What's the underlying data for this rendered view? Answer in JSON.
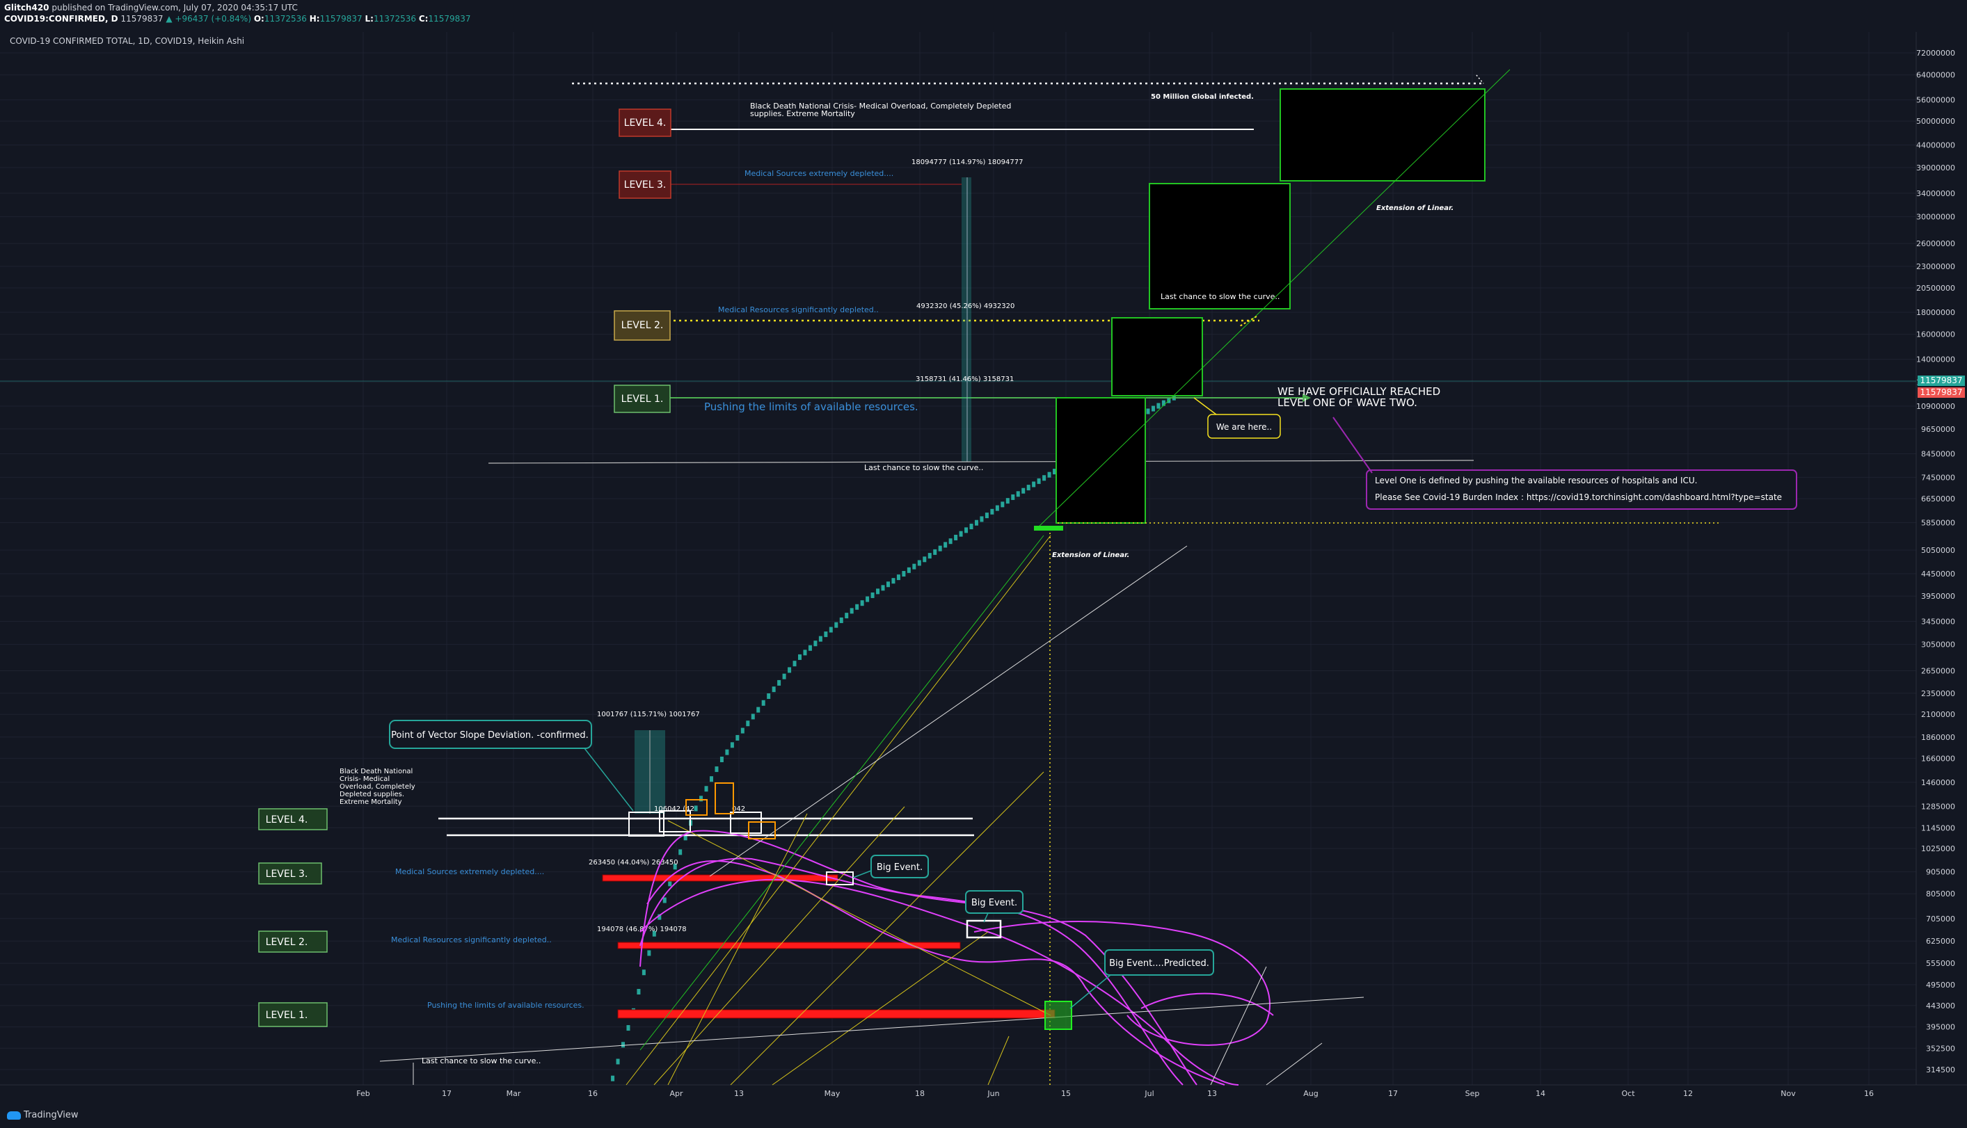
{
  "header": {
    "user": "Glitch420",
    "published": " published on TradingView.com, July 07, 2020 04:35:17 UTC",
    "symbol": "COVID19:CONFIRMED, D",
    "last": "11579837",
    "change": "▲ +96437 (+0.84%)",
    "o_label": "O:",
    "o": "11372536",
    "h_label": "H:",
    "h": "11579837",
    "l_label": "L:",
    "l": "11372536",
    "c_label": "C:",
    "c": "11579837"
  },
  "chart_legend": "COVID-19 CONFIRMED TOTAL, 1D, COVID19, Heikin Ashi",
  "footer": {
    "brand": "TradingView"
  },
  "price_badges": {
    "top": "11579837",
    "bottom": "11579837"
  },
  "colors": {
    "background": "#131722",
    "candle": "#26a69a",
    "level1": "#4caf50",
    "level2": "#f5e01e",
    "level3": "#ff4040",
    "magenta": "#e040fb",
    "red_band": "#ff1a1a",
    "green_box": "#22dd22"
  },
  "chart_data": {
    "type": "line",
    "title": "COVID-19 CONFIRMED TOTAL, 1D, COVID19, Heikin Ashi",
    "y_scale": "log",
    "x_ticks": [
      "Feb",
      "17",
      "Mar",
      "16",
      "Apr",
      "13",
      "May",
      "18",
      "Jun",
      "15",
      "Jul",
      "13",
      "Aug",
      "17",
      "Sep",
      "14",
      "Oct",
      "12",
      "Nov",
      "16"
    ],
    "y_ticks": [
      "72000000",
      "64000000",
      "56000000",
      "50000000",
      "44000000",
      "39000000",
      "34000000",
      "30000000",
      "26000000",
      "23000000",
      "20500000",
      "18000000",
      "16000000",
      "14000000",
      "12400000",
      "10900000",
      "9650000",
      "8450000",
      "7450000",
      "6650000",
      "5850000",
      "5050000",
      "4450000",
      "3950000",
      "3450000",
      "3050000",
      "2650000",
      "2350000",
      "2100000",
      "1860000",
      "1660000",
      "1460000",
      "1285000",
      "1145000",
      "1025000",
      "905000",
      "805000",
      "705000",
      "625000",
      "555000",
      "495000",
      "443000",
      "395000",
      "352500",
      "314500"
    ],
    "series": [
      {
        "x": [
          "2020-03-20",
          "2020-03-24",
          "2020-03-28",
          "2020-04-01",
          "2020-04-05",
          "2020-04-10",
          "2020-04-15",
          "2020-04-20",
          "2020-04-25",
          "2020-05-01",
          "2020-05-05",
          "2020-05-10",
          "2020-05-15",
          "2020-05-20",
          "2020-05-25",
          "2020-06-01",
          "2020-06-05",
          "2020-06-10",
          "2020-06-15",
          "2020-06-20",
          "2020-06-25",
          "2020-07-01",
          "2020-07-07"
        ],
        "y": [
          300000,
          430000,
          650000,
          930000,
          1270000,
          1650000,
          2000000,
          2400000,
          2850000,
          3300000,
          3650000,
          4050000,
          4450000,
          4900000,
          5400000,
          6200000,
          6700000,
          7300000,
          7950000,
          8750000,
          9650000,
          10600000,
          11579837
        ]
      }
    ],
    "last_value": 11579837
  },
  "annotations": {
    "top_levels": [
      {
        "label": "LEVEL 4.",
        "text": "Black Death National Crisis- Medical Overload, Completely Depleted supplies. Extreme Mortality"
      },
      {
        "label": "LEVEL 3.",
        "text": "Medical Sources extremely depleted...."
      },
      {
        "label": "LEVEL 2.",
        "text": "Medical Resources significantly depleted.."
      },
      {
        "label": "LEVEL 1.",
        "text": "Pushing the limits of available resources."
      }
    ],
    "bottom_levels": [
      {
        "label": "LEVEL 4.",
        "text": "Black Death National Crisis- Medical Overload, Completely Depleted supplies. Extreme Mortality"
      },
      {
        "label": "LEVEL 3.",
        "text": "Medical Sources extremely depleted...."
      },
      {
        "label": "LEVEL 2.",
        "text": "Medical Resources significantly depleted.."
      },
      {
        "label": "LEVEL 1.",
        "text": "Pushing the limits of available resources."
      }
    ],
    "measure_top_1": "18094777 (114.97%) 18094777",
    "measure_top_2": "4932320 (45.26%) 4932320",
    "measure_top_3": "3158731 (41.46%) 3158731",
    "measure_bot_1": "1001767 (115.71%) 1001767",
    "measure_bot_2": "263450 (44.04%) 263450",
    "measure_bot_3": "194078 (46.87%) 194078",
    "measure_bot_4": "106042 (42",
    "measure_bot_5": "042",
    "global_infected": "50 Million Global infected.",
    "ext_linear_1": "Extension of Linear.",
    "ext_linear_2": "Extension of Linear.",
    "last_chance_1": "Last chance to slow the curve..",
    "last_chance_2": "Last chance to slow the curve..",
    "last_chance_3": "Last chance to slow the curve..",
    "reached_1": "WE HAVE OFFICIALLY REACHED",
    "reached_2": "LEVEL ONE OF WAVE TWO.",
    "we_are_here": "We are here..",
    "info_1": "Level One is defined by pushing the available resources of hospitals and ICU.",
    "info_2": "Please See Covid-19 Burden Index : https://covid19.torchinsight.com/dashboard.html?type=state",
    "vector_slope": "Point of Vector Slope Deviation. -confirmed.",
    "big_event_1": "Big Event.",
    "big_event_2": "Big Event.",
    "big_event_3": "Big Event....Predicted."
  }
}
